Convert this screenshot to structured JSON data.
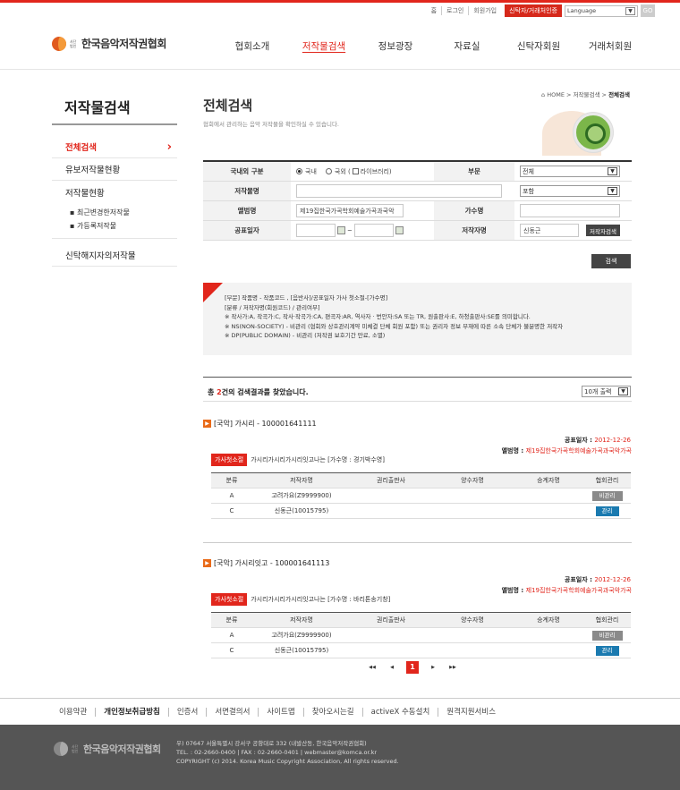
{
  "topbar": {
    "links": [
      "홈",
      "로그인",
      "회원가입"
    ],
    "cert_button": "신탁자/거래처인증",
    "language_select": "Language",
    "go_button": "GO"
  },
  "logo": {
    "small": "사단법인",
    "name": "한국음악저작권협회"
  },
  "gnb": [
    "협회소개",
    "저작물검색",
    "정보광장",
    "자료실",
    "신탁자회원",
    "거래처회원"
  ],
  "lnb": {
    "title": "저작물검색",
    "items": [
      {
        "label": "전체검색"
      },
      {
        "label": "유보저작물현황"
      },
      {
        "label": "저작물현황"
      }
    ],
    "subitems": [
      "최근변경한저작물",
      "가등록저작물"
    ],
    "last_item": "신탁해지자의저작물"
  },
  "page": {
    "title": "전체검색",
    "desc": "협회에서 관리하는 음악 저작물을 확인하실 수 있습니다.",
    "breadcrumb_home": "HOME",
    "breadcrumb_sep": ">",
    "breadcrumb_mid": "저작물검색",
    "breadcrumb_current": "전체검색"
  },
  "form": {
    "label_region": "국내외 구분",
    "radio_domestic": "국내",
    "radio_foreign": "국외 (",
    "chk_library": "라이브러리)",
    "label_category": "부문",
    "category_value": "전체",
    "label_title": "저작물명",
    "title_value": "",
    "match_value": "포함",
    "label_album": "앨범명",
    "album_value": "제19집한국가곡학회예술가곡과국악",
    "label_singer": "가수명",
    "singer_value": "",
    "label_date": "공표일자",
    "date_from": "",
    "date_sep": "~",
    "date_to": "",
    "label_author": "저작자명",
    "author_value": "신동근",
    "author_search_button": "저작자검색",
    "search_button": "검색"
  },
  "notice": [
    "[부문] 작품명 - 작품코드 , [음반사]/공표일자 가사 첫소절-[가수명]",
    "[분류 / 저작자명(회원코드) / 관리여부]",
    "※ 작사가:A, 작곡가:C, 작사·작곡가:CA, 편곡자:AR, 역사자 · 번안자:SA 또는 TR, 원출판사:E, 하청출판사:SE를 의미합니다.",
    "※ NS(NON-SOCIETY) - 비관리 (협회와 상호관리계약 미체결 단체 회원 포함) 또는 권리자 정보 부재에 따른 소속 단체가 불분명한 저작자",
    "※ DP(PUBLIC DOMAIN) - 비관리 (저작권 보호기간 만료, 소멸)"
  ],
  "results": {
    "count_prefix": "총 ",
    "count": "2",
    "count_suffix": "건의 검색결과를 찾았습니다.",
    "per_page": "10개 출력"
  },
  "table_headers": [
    "분류",
    "저작자명",
    "권리출판사",
    "양수자명",
    "승계자명",
    "협회관리"
  ],
  "items": [
    {
      "title": "[국악] 가시리 - 100001641111",
      "date_label": "공표일자 : ",
      "date": "2012-12-26",
      "album_label": "앨범명 : ",
      "album": "제19집한국가곡학회예술가곡과국악가곡",
      "tag": "가사첫소절",
      "lyric": "가시리가시리가시리잇고나는 [가수명 : 경기박수영]",
      "rows": [
        {
          "c1": "A",
          "c2": "고려가요(Z9999900)",
          "c3": "",
          "c4": "",
          "c5": "",
          "status": "비관리"
        },
        {
          "c1": "C",
          "c2": "신동근(10015795)",
          "c3": "",
          "c4": "",
          "c5": "",
          "status": "관리"
        }
      ]
    },
    {
      "title": "[국악] 가시리잇고 - 100001641113",
      "date_label": "공표일자 : ",
      "date": "2012-12-26",
      "album_label": "앨범명 : ",
      "album": "제19집한국가곡학회예술가곡과국악가곡",
      "tag": "가사첫소절",
      "lyric": "가시리가시리가시리잇고나는 [가수명 : 바리톤송기창]",
      "rows": [
        {
          "c1": "A",
          "c2": "고려가요(Z9999900)",
          "c3": "",
          "c4": "",
          "c5": "",
          "status": "비관리"
        },
        {
          "c1": "C",
          "c2": "신동근(10015795)",
          "c3": "",
          "c4": "",
          "c5": "",
          "status": "관리"
        }
      ]
    }
  ],
  "pager": {
    "first": "◀◀",
    "prev": "◀",
    "current": "1",
    "next": "▶",
    "last": "▶▶"
  },
  "footer_links": [
    "이용약관",
    "개인정보취급방침",
    "인증서",
    "서면결의서",
    "사이트맵",
    "찾아오시는길",
    "activeX 수동설치",
    "원격지원서비스"
  ],
  "footer": {
    "logo": "한국음악저작권협회",
    "logo_small": "사단법인",
    "address": "우) 07647 서울특별시 강서구 공항대로 332 (내발산동, 한국음악저작권협회)",
    "tel": "TEL. : 02-2660-0400 | FAX : 02-2660-0401 | webmaster@komca.or.kr",
    "copyright": "COPYRIGHT (c) 2014. Korea Music Copyright Association, All rights reserved."
  }
}
